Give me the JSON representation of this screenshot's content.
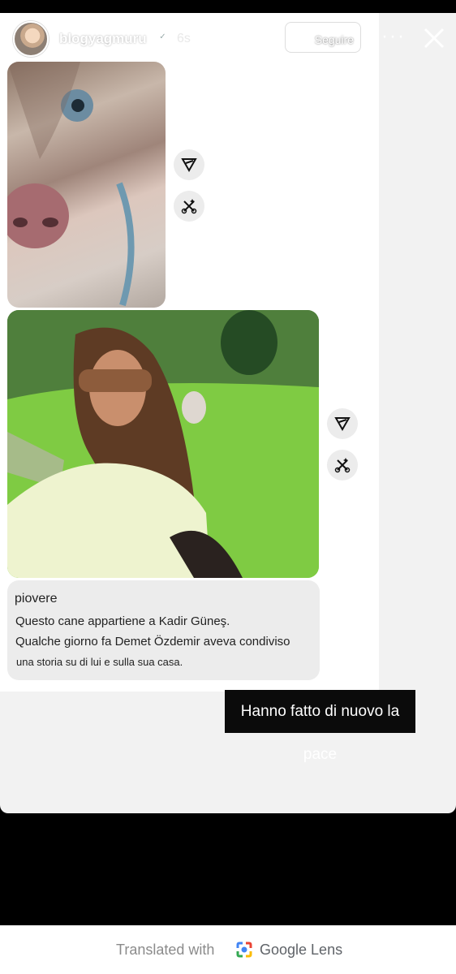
{
  "header": {
    "username": "blogyagmuru",
    "time": "6s",
    "follow_label": "Seguire",
    "more_label": "···"
  },
  "caption": {
    "title": "piovere",
    "line1": "Questo cane appartiene a Kadir Güneş.",
    "line2": "Qualche giorno fa Demet Özdemir aveva condiviso",
    "line3": "una storia su di lui e sulla sua casa."
  },
  "overlay": {
    "text": "Hanno fatto di nuovo la pace"
  },
  "footer": {
    "prefix": "Translated with",
    "brand": "Google Lens"
  },
  "colors": {
    "background": "#000000",
    "story_bg": "#f2f2f2",
    "caption_bg": "#ececec",
    "overlay_bg": "#0b0b0b"
  },
  "icons": {
    "send": "send-icon",
    "edit": "edit-icon",
    "close": "close-icon",
    "verified": "verified-icon",
    "lens": "google-lens-icon"
  }
}
